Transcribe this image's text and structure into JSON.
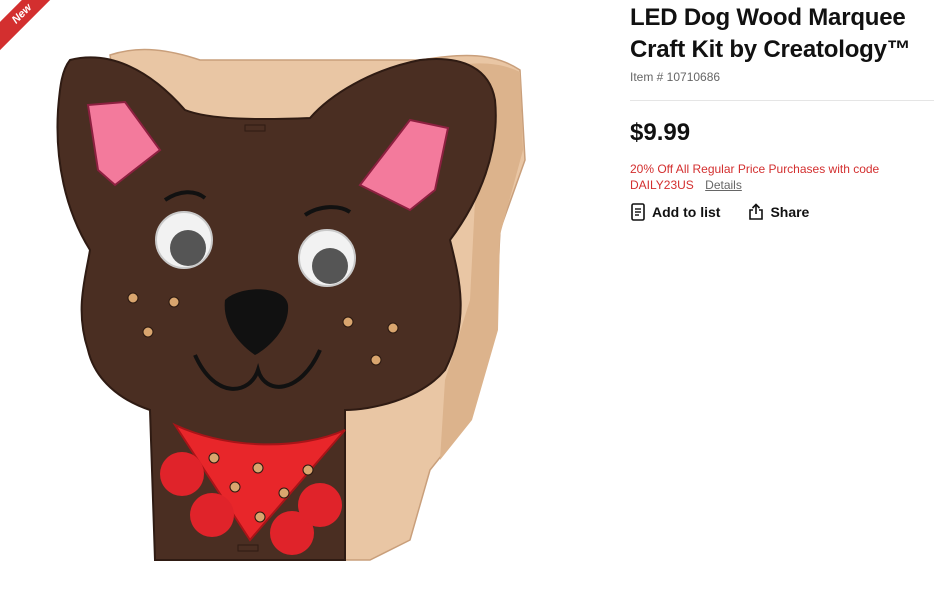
{
  "badge": {
    "label": "New",
    "color": "#d32f2f"
  },
  "product": {
    "title": "LED Dog Wood Marquee Craft Kit by Creatology™",
    "item_number": "Item # 10710686",
    "price": "$9.99",
    "promo": {
      "text_line1": "20% Off All Regular Price Purchases with code",
      "code": "DAILY23US",
      "details_label": "Details",
      "color": "#d32f2f"
    }
  },
  "actions": {
    "add_to_list": {
      "label": "Add to list",
      "icon": "list-icon"
    },
    "share": {
      "label": "Share",
      "icon": "share-icon"
    }
  }
}
